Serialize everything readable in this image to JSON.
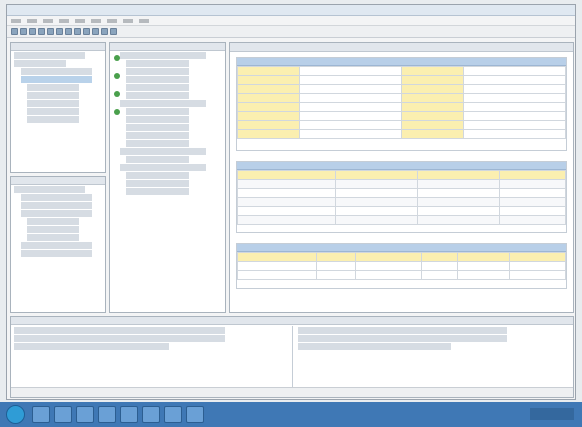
{
  "colors": {
    "key_cell": "#fbefb0",
    "section_header": "#b8cfe8",
    "taskbar": "#3f78b5",
    "status_ok": "#4aa04c"
  },
  "icons": [
    "start-orb-icon",
    "task-app-icon",
    "status-bullet-icon",
    "toolbar-icon"
  ]
}
